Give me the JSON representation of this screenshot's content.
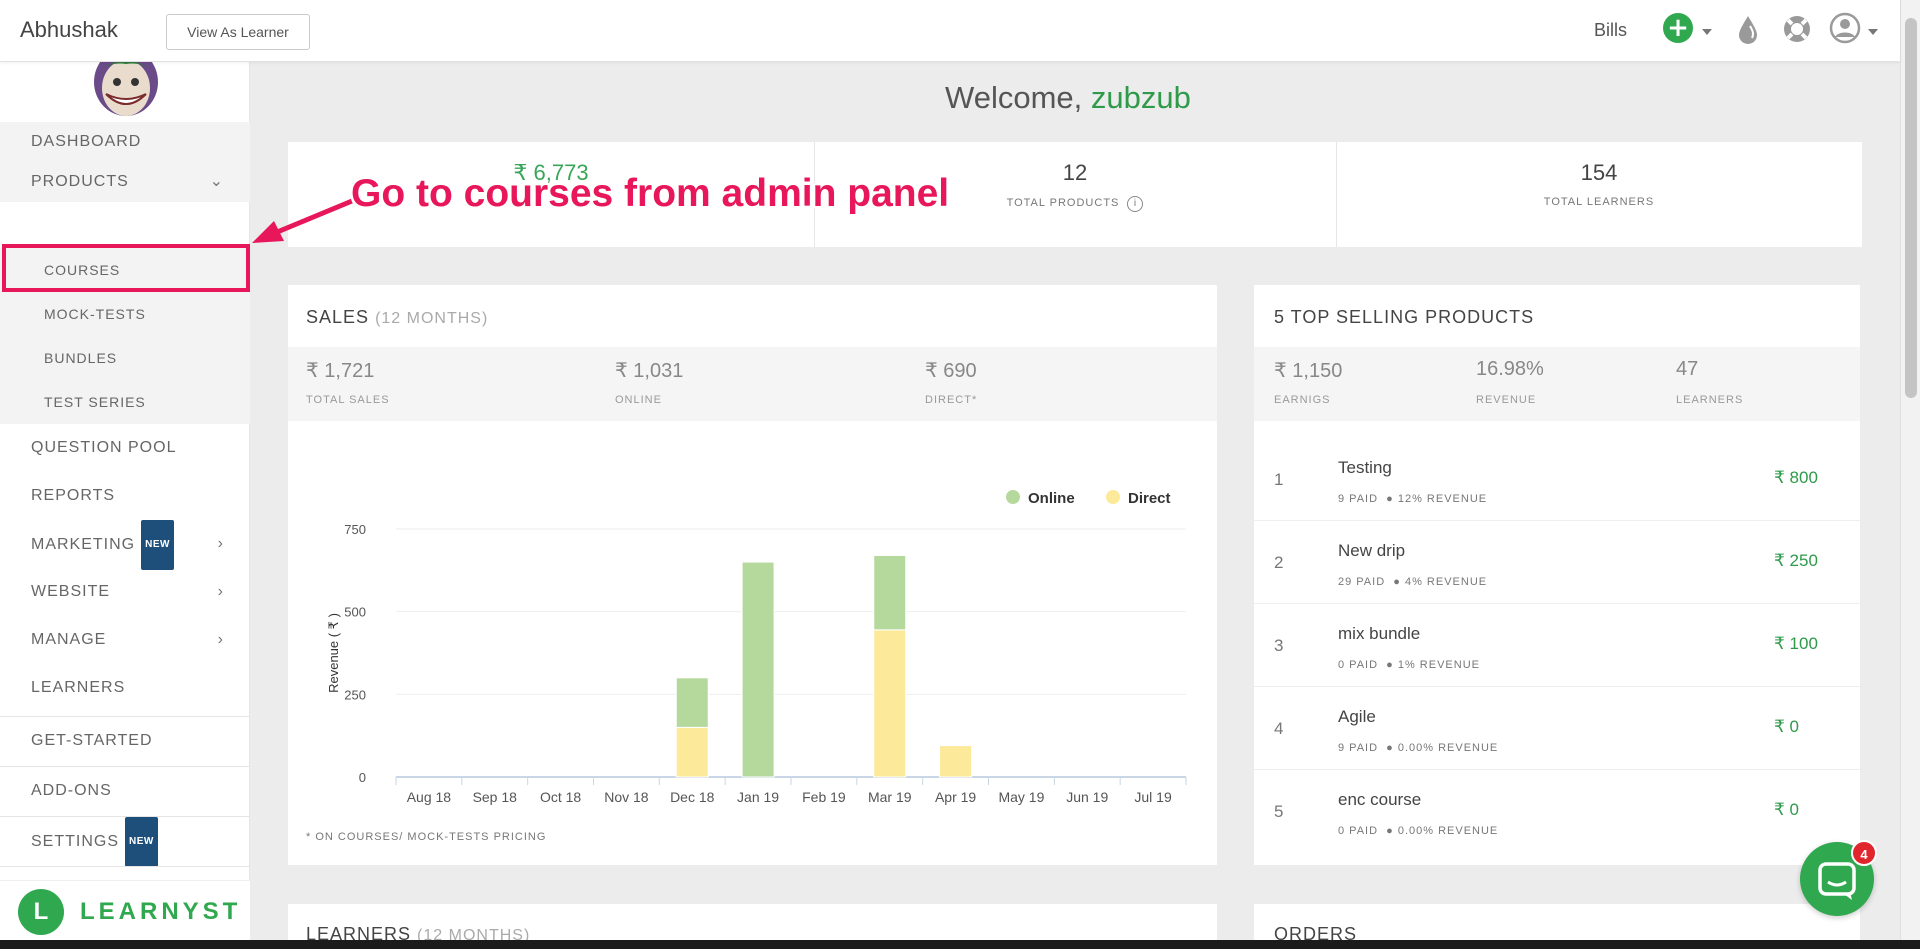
{
  "header": {
    "brand": "Abhushak",
    "view_as_learner": "View As Learner",
    "bills": "Bills"
  },
  "sidebar": {
    "items": [
      {
        "label": "DASHBOARD"
      },
      {
        "label": "PRODUCTS"
      },
      {
        "label": "COURSES"
      },
      {
        "label": "MOCK-TESTS"
      },
      {
        "label": "BUNDLES"
      },
      {
        "label": "TEST SERIES"
      },
      {
        "label": "QUESTION POOL"
      },
      {
        "label": "REPORTS"
      },
      {
        "label": "MARKETING",
        "badge": "NEW"
      },
      {
        "label": "WEBSITE"
      },
      {
        "label": "MANAGE"
      },
      {
        "label": "LEARNERS"
      },
      {
        "label": "GET-STARTED"
      },
      {
        "label": "ADD-ONS"
      },
      {
        "label": "SETTINGS",
        "badge": "NEW"
      }
    ],
    "logo_letter": "L",
    "logo_text": "LEARNYST"
  },
  "welcome": {
    "prefix": "Welcome,",
    "name": "zubzub"
  },
  "stats": {
    "revenue_value": "₹ 6,773",
    "total_products_value": "12",
    "total_products_label": "TOTAL PRODUCTS",
    "total_learners_value": "154",
    "total_learners_label": "TOTAL LEARNERS"
  },
  "callout": {
    "text": "Go to courses from admin panel"
  },
  "sales": {
    "title": "SALES",
    "subtitle": "(12 MONTHS)",
    "summary": [
      {
        "value": "₹ 1,721",
        "label": "TOTAL SALES"
      },
      {
        "value": "₹ 1,031",
        "label": "ONLINE"
      },
      {
        "value": "₹ 690",
        "label": "DIRECT*"
      }
    ],
    "footnote": "* ON COURSES/ MOCK-TESTS PRICING"
  },
  "top_selling": {
    "title": "5 TOP SELLING PRODUCTS",
    "summary": [
      {
        "value": "₹ 1,150",
        "label": "EARNIGS"
      },
      {
        "value": "16.98%",
        "label": "REVENUE"
      },
      {
        "value": "47",
        "label": "LEARNERS"
      }
    ],
    "items": [
      {
        "rank": "1",
        "name": "Testing",
        "paid": "9 PAID",
        "revenue": "12% REVENUE",
        "amount": "₹ 800"
      },
      {
        "rank": "2",
        "name": "New drip",
        "paid": "29 PAID",
        "revenue": "4% REVENUE",
        "amount": "₹ 250"
      },
      {
        "rank": "3",
        "name": "mix bundle",
        "paid": "0 PAID",
        "revenue": "1% REVENUE",
        "amount": "₹ 100"
      },
      {
        "rank": "4",
        "name": "Agile",
        "paid": "9 PAID",
        "revenue": "0.00% REVENUE",
        "amount": "₹ 0"
      },
      {
        "rank": "5",
        "name": "enc course",
        "paid": "0 PAID",
        "revenue": "0.00% REVENUE",
        "amount": "₹ 0"
      }
    ]
  },
  "bottom_cards": {
    "learners_title": "LEARNERS",
    "learners_subtitle": "(12 MONTHS)",
    "orders_title": "ORDERS"
  },
  "chat": {
    "badge_count": "4"
  },
  "colors": {
    "accent_green": "#2fa84f",
    "online": "#b5d99c",
    "direct": "#fde99a",
    "callout": "#e8165a"
  },
  "chart_data": {
    "type": "bar",
    "stacked": true,
    "categories": [
      "Aug 18",
      "Sep 18",
      "Oct 18",
      "Nov 18",
      "Dec 18",
      "Jan 19",
      "Feb 19",
      "Mar 19",
      "Apr 19",
      "May 19",
      "Jun 19",
      "Jul 19"
    ],
    "series": [
      {
        "name": "Direct",
        "values": [
          0,
          0,
          0,
          0,
          150,
          0,
          0,
          445,
          95,
          0,
          0,
          0
        ]
      },
      {
        "name": "Online",
        "values": [
          0,
          0,
          0,
          0,
          150,
          650,
          0,
          225,
          0,
          0,
          0,
          0
        ]
      }
    ],
    "ylabel": "Revenue ( ₹ )",
    "yticks": [
      0,
      250,
      500,
      750
    ],
    "ylim": [
      0,
      750
    ],
    "legend": "top-right",
    "grid": true
  }
}
